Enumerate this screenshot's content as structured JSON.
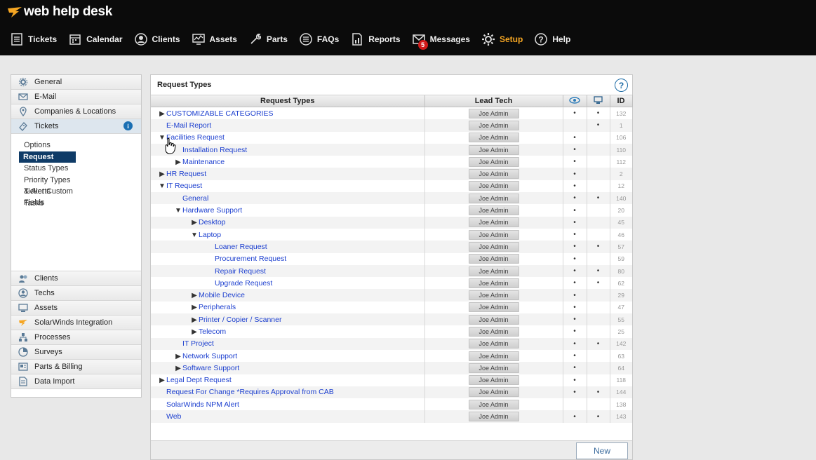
{
  "app": {
    "logo_text": "web help desk"
  },
  "nav": [
    {
      "label": "Tickets",
      "icon": "tickets-icon"
    },
    {
      "label": "Calendar",
      "icon": "calendar-icon"
    },
    {
      "label": "Clients",
      "icon": "clients-icon"
    },
    {
      "label": "Assets",
      "icon": "assets-icon"
    },
    {
      "label": "Parts",
      "icon": "parts-icon"
    },
    {
      "label": "FAQs",
      "icon": "faqs-icon"
    },
    {
      "label": "Reports",
      "icon": "reports-icon"
    },
    {
      "label": "Messages",
      "icon": "messages-icon",
      "badge": "5"
    },
    {
      "label": "Setup",
      "icon": "setup-icon",
      "active": true
    },
    {
      "label": "Help",
      "icon": "help-icon"
    }
  ],
  "sidebar": {
    "top_items": [
      {
        "label": "General",
        "icon": "gear-icon"
      },
      {
        "label": "E-Mail",
        "icon": "envelope-icon"
      },
      {
        "label": "Companies & Locations",
        "icon": "location-pin-icon"
      },
      {
        "label": "Tickets",
        "icon": "ticket-icon",
        "selected": true,
        "info": "i"
      }
    ],
    "sub_items": [
      {
        "label": "Options"
      },
      {
        "label": "Request Types",
        "selected": true
      },
      {
        "label": "Status Types"
      },
      {
        "label": "Priority Types & Alerts"
      },
      {
        "label": "Ticket Custom Fields"
      },
      {
        "label": "Tasks"
      }
    ],
    "bottom_items": [
      {
        "label": "Clients",
        "icon": "clients-icon"
      },
      {
        "label": "Techs",
        "icon": "techs-icon"
      },
      {
        "label": "Assets",
        "icon": "monitor-icon"
      },
      {
        "label": "SolarWinds Integration",
        "icon": "solarwinds-icon"
      },
      {
        "label": "Processes",
        "icon": "processes-icon"
      },
      {
        "label": "Surveys",
        "icon": "survey-icon"
      },
      {
        "label": "Parts & Billing",
        "icon": "billing-icon"
      },
      {
        "label": "Data Import",
        "icon": "import-icon"
      }
    ]
  },
  "panel": {
    "title": "Request Types",
    "help": "?",
    "columns": {
      "name": "Request Types",
      "tech": "Lead Tech",
      "id": "ID"
    },
    "new_label": "New"
  },
  "rows": [
    {
      "name": "CUSTOMIZABLE CATEGORIES",
      "level": 0,
      "tri": "right",
      "tech": "Joe Admin",
      "v": true,
      "d": true,
      "id": "132"
    },
    {
      "name": "E-Mail Report",
      "level": 0,
      "tri": "",
      "tech": "Joe Admin",
      "v": false,
      "d": true,
      "id": "1"
    },
    {
      "name": "Facilities Request",
      "level": 0,
      "tri": "down",
      "tech": "Joe Admin",
      "v": true,
      "d": false,
      "id": "106"
    },
    {
      "name": "Installation Request",
      "level": 1,
      "tri": "",
      "tech": "Joe Admin",
      "v": true,
      "d": false,
      "id": "110"
    },
    {
      "name": "Maintenance",
      "level": 1,
      "tri": "right",
      "tech": "Joe Admin",
      "v": true,
      "d": false,
      "id": "112"
    },
    {
      "name": "HR Request",
      "level": 0,
      "tri": "right",
      "tech": "Joe Admin",
      "v": true,
      "d": false,
      "id": "2"
    },
    {
      "name": "IT Request",
      "level": 0,
      "tri": "down",
      "tech": "Joe Admin",
      "v": true,
      "d": false,
      "id": "12"
    },
    {
      "name": "General",
      "level": 1,
      "tri": "",
      "tech": "Joe Admin",
      "v": true,
      "d": true,
      "id": "140"
    },
    {
      "name": "Hardware Support",
      "level": 1,
      "tri": "down",
      "tech": "Joe Admin",
      "v": true,
      "d": false,
      "id": "20"
    },
    {
      "name": "Desktop",
      "level": 2,
      "tri": "right",
      "tech": "Joe Admin",
      "v": true,
      "d": false,
      "id": "45"
    },
    {
      "name": "Laptop",
      "level": 2,
      "tri": "down",
      "tech": "Joe Admin",
      "v": true,
      "d": false,
      "id": "46"
    },
    {
      "name": "Loaner Request",
      "level": 3,
      "tri": "",
      "tech": "Joe Admin",
      "v": true,
      "d": true,
      "id": "57"
    },
    {
      "name": "Procurement Request",
      "level": 3,
      "tri": "",
      "tech": "Joe Admin",
      "v": true,
      "d": false,
      "id": "59"
    },
    {
      "name": "Repair Request",
      "level": 3,
      "tri": "",
      "tech": "Joe Admin",
      "v": true,
      "d": true,
      "id": "80"
    },
    {
      "name": "Upgrade Request",
      "level": 3,
      "tri": "",
      "tech": "Joe Admin",
      "v": true,
      "d": true,
      "id": "62"
    },
    {
      "name": "Mobile Device",
      "level": 2,
      "tri": "right",
      "tech": "Joe Admin",
      "v": true,
      "d": false,
      "id": "29"
    },
    {
      "name": "Peripherals",
      "level": 2,
      "tri": "right",
      "tech": "Joe Admin",
      "v": true,
      "d": false,
      "id": "47"
    },
    {
      "name": "Printer / Copier / Scanner",
      "level": 2,
      "tri": "right",
      "tech": "Joe Admin",
      "v": true,
      "d": false,
      "id": "55"
    },
    {
      "name": "Telecom",
      "level": 2,
      "tri": "right",
      "tech": "Joe Admin",
      "v": true,
      "d": false,
      "id": "25"
    },
    {
      "name": "IT Project",
      "level": 1,
      "tri": "",
      "tech": "Joe Admin",
      "v": true,
      "d": true,
      "id": "142"
    },
    {
      "name": "Network Support",
      "level": 1,
      "tri": "right",
      "tech": "Joe Admin",
      "v": true,
      "d": false,
      "id": "63"
    },
    {
      "name": "Software Support",
      "level": 1,
      "tri": "right",
      "tech": "Joe Admin",
      "v": true,
      "d": false,
      "id": "64"
    },
    {
      "name": "Legal Dept Request",
      "level": 0,
      "tri": "right",
      "tech": "Joe Admin",
      "v": true,
      "d": false,
      "id": "118"
    },
    {
      "name": "Request For Change *Requires Approval from CAB",
      "level": 0,
      "tri": "",
      "tech": "Joe Admin",
      "v": true,
      "d": true,
      "id": "144"
    },
    {
      "name": "SolarWinds NPM Alert",
      "level": 0,
      "tri": "",
      "tech": "Joe Admin",
      "v": false,
      "d": false,
      "id": "138"
    },
    {
      "name": "Web",
      "level": 0,
      "tri": "",
      "tech": "Joe Admin",
      "v": true,
      "d": true,
      "id": "143"
    }
  ],
  "dot_char": "•",
  "colors": {
    "link": "#1c3fcf",
    "setup_accent": "#f5a623",
    "selected_sub": "#0f3b67",
    "badge": "#d01a1a"
  }
}
